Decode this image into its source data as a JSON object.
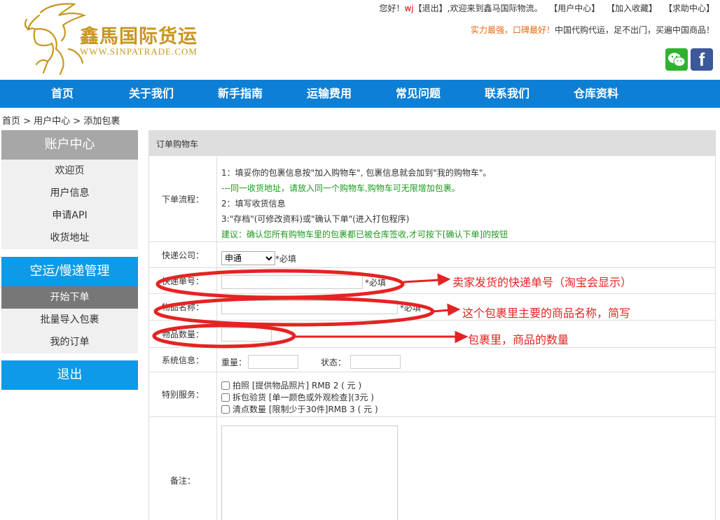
{
  "brand": {
    "name_cn": "鑫馬国际货运",
    "name_en": "WWW.SINPATRADE.COM",
    "color": "#c8951f"
  },
  "topbar": {
    "greeting": "您好！",
    "username": "wj",
    "logout": "【退出】",
    "welcome": ",欢迎来到鑫马国际物流。",
    "links": [
      "【用户中心】",
      "【加入收藏】",
      "【求助中心】"
    ]
  },
  "slogan": {
    "highlight": "实力最强，口碑最好！",
    "rest": "中国代购代运，足不出门，买遍中国商品！"
  },
  "social": {
    "wechat_icon": "wechat-icon",
    "facebook_icon": "facebook-icon",
    "facebook_glyph": "f"
  },
  "nav": {
    "items": [
      "首页",
      "关于我们",
      "新手指南",
      "运输费用",
      "常见问题",
      "联系我们",
      "仓库资料"
    ],
    "color": "#0d7fd4"
  },
  "breadcrumb": "首页 > 用户中心 > 添加包裹",
  "sidebar": {
    "account_title": "账户中心",
    "account_items": [
      "欢迎页",
      "用户信息",
      "申请API",
      "收货地址"
    ],
    "shipping_title": "空运/慢递管理",
    "shipping_items": [
      "开始下单",
      "批量导入包裹",
      "我的订单"
    ],
    "active_item": "开始下单",
    "logout_title": "退出"
  },
  "form": {
    "title": "订单购物车",
    "process_label": "下单流程：",
    "steps": [
      "1：填妥你的包裹信息按\"加入购物车\", 包裹信息就会加到\"我的购物车\"。",
      "---同一收货地址，请放入同一个购物车,购物车可无限增加包裹。",
      "2：填写收货信息",
      "3:\"存档\"(可修改资料)或\"确认下单\"(进入打包程序)",
      "建议：确认您所有购物车里的包裹都已被仓库签收,才可按下[确认下单]的按钮"
    ],
    "courier_label": "快递公司：",
    "courier_value": "申通",
    "required": "*必填",
    "tracking_label": "快递单号：",
    "tracking_value": "",
    "item_name_label": "物品名称：",
    "item_name_value": "",
    "quantity_label": "物品数量：",
    "quantity_value": "",
    "system_label": "系统信息：",
    "weight_label": "重量：",
    "weight_value": "",
    "status_label": "状态：",
    "status_value": "",
    "service_label": "特别服务：",
    "services": [
      "拍照 [提供物品照片] RMB 2 ( 元 )",
      "拆包验货 [单一颜色或外观检查](3元 )",
      "清点数量 [限制少于30件]RMB 3 ( 元 )"
    ],
    "notes_label": "备注：",
    "notes_value": ""
  },
  "annotations": {
    "tracking_note": "卖家发货的快递单号（淘宝会显示）",
    "item_name_note": "这个包裹里主要的商品名称，简写",
    "quantity_note": "包裹里，商品的数量",
    "color": "#e52323"
  }
}
